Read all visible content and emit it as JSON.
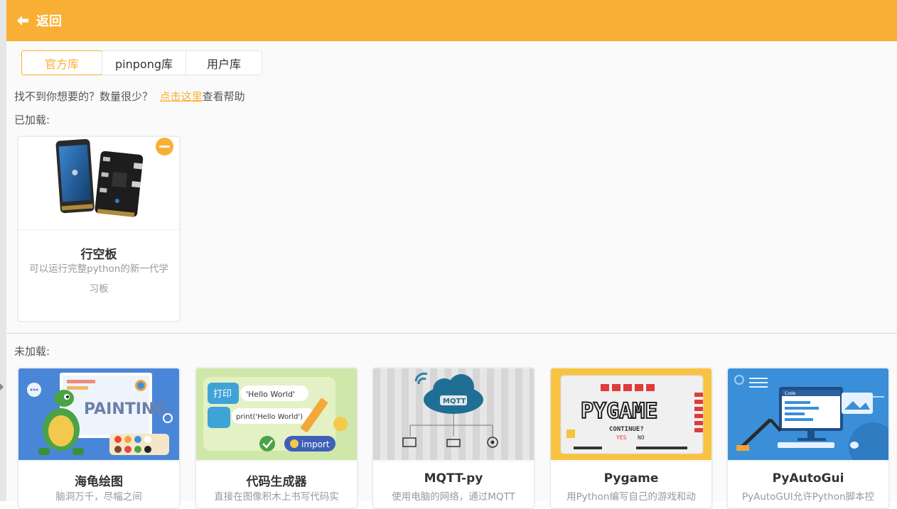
{
  "header": {
    "back_label": "返回"
  },
  "tabs": [
    {
      "label": "官方库",
      "active": true
    },
    {
      "label": "pinpong库",
      "active": false
    },
    {
      "label": "用户库",
      "active": false
    }
  ],
  "help": {
    "prefix": "找不到你想要的？数量很少？",
    "link": "点击这里",
    "suffix": "查看帮助"
  },
  "loaded": {
    "title": "已加载:",
    "items": [
      {
        "name": "行空板",
        "desc": "可以运行完整python的新一代学习板"
      }
    ]
  },
  "unloaded": {
    "title": "未加载:",
    "items": [
      {
        "name": "海龟绘图",
        "desc": "脑洞万千，尽幅之间"
      },
      {
        "name": "代码生成器",
        "desc": "直接在图像积木上书写代码实"
      },
      {
        "name": "MQTT-py",
        "desc": "使用电脑的网络，通过MQTT"
      },
      {
        "name": "Pygame",
        "desc": "用Python编写自己的游戏和动"
      },
      {
        "name": "PyAutoGui",
        "desc": "PyAutoGUI允许Python脚本控"
      }
    ]
  },
  "art": {
    "painting_text": "PAINTING",
    "code_print_cn": "打印",
    "code_hello": "'Hello World'",
    "code_print_py": "print('Hello World')",
    "code_import": "import",
    "mqtt_label": "MQTT",
    "pygame_title": "PYGAME",
    "pygame_continue": "CONTINUE?",
    "pygame_yes": "YES",
    "pygame_no": "NO",
    "screen_code_label": "Code"
  },
  "colors": {
    "accent": "#f9af33"
  }
}
